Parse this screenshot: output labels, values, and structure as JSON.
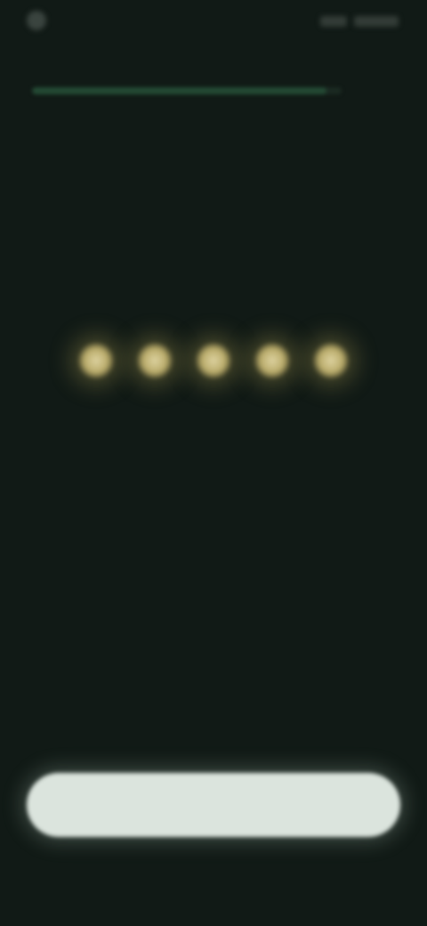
{
  "status_bar": {
    "time": "",
    "icons": [
      "app-icon",
      "signal-icon",
      "battery-icon"
    ]
  },
  "progress": {
    "value": 0.95
  },
  "rating": {
    "max": 5,
    "icon": "star-icon",
    "color": "#d4c78a"
  },
  "content": {
    "headline": "",
    "subtext": ""
  },
  "actions": {
    "primary_label": "",
    "secondary_label": ""
  },
  "colors": {
    "background": "#111a16",
    "accent": "#244a34",
    "button": "#dbe4dd"
  }
}
